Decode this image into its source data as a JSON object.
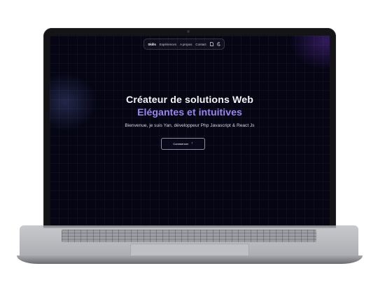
{
  "nav": {
    "items": [
      "Skills",
      "Expériences",
      "A propos",
      "Contact"
    ],
    "icons": [
      "file-icon",
      "moon-icon"
    ]
  },
  "hero": {
    "title_line1": "Créateur de solutions Web",
    "title_line2": "Elégantes et intuitives",
    "subtitle": "Bienvenue, je suis Yan, développeur Php Javascript & React Js",
    "cta_label": "Commencer",
    "cta_arrow": "↑"
  },
  "colors": {
    "screen_bg": "#050514",
    "accent": "#9b86f0",
    "device_silver": "#b7b8bc"
  }
}
